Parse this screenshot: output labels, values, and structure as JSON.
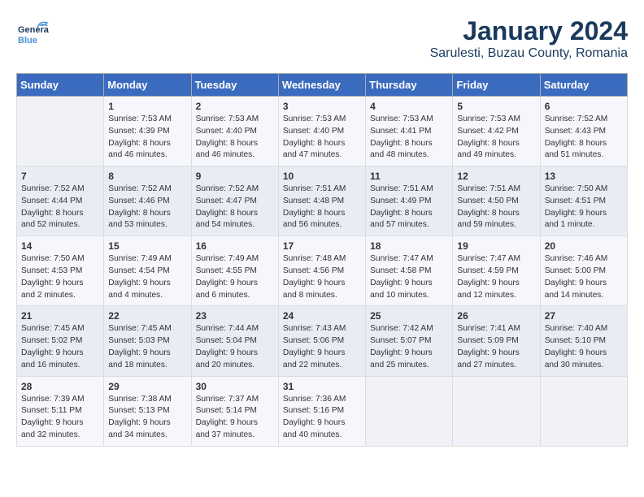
{
  "header": {
    "logo_general": "General",
    "logo_blue": "Blue",
    "title": "January 2024",
    "subtitle": "Sarulesti, Buzau County, Romania"
  },
  "days_of_week": [
    "Sunday",
    "Monday",
    "Tuesday",
    "Wednesday",
    "Thursday",
    "Friday",
    "Saturday"
  ],
  "weeks": [
    [
      {
        "day": "",
        "info": ""
      },
      {
        "day": "1",
        "info": "Sunrise: 7:53 AM\nSunset: 4:39 PM\nDaylight: 8 hours\nand 46 minutes."
      },
      {
        "day": "2",
        "info": "Sunrise: 7:53 AM\nSunset: 4:40 PM\nDaylight: 8 hours\nand 46 minutes."
      },
      {
        "day": "3",
        "info": "Sunrise: 7:53 AM\nSunset: 4:40 PM\nDaylight: 8 hours\nand 47 minutes."
      },
      {
        "day": "4",
        "info": "Sunrise: 7:53 AM\nSunset: 4:41 PM\nDaylight: 8 hours\nand 48 minutes."
      },
      {
        "day": "5",
        "info": "Sunrise: 7:53 AM\nSunset: 4:42 PM\nDaylight: 8 hours\nand 49 minutes."
      },
      {
        "day": "6",
        "info": "Sunrise: 7:52 AM\nSunset: 4:43 PM\nDaylight: 8 hours\nand 51 minutes."
      }
    ],
    [
      {
        "day": "7",
        "info": "Sunrise: 7:52 AM\nSunset: 4:44 PM\nDaylight: 8 hours\nand 52 minutes."
      },
      {
        "day": "8",
        "info": "Sunrise: 7:52 AM\nSunset: 4:46 PM\nDaylight: 8 hours\nand 53 minutes."
      },
      {
        "day": "9",
        "info": "Sunrise: 7:52 AM\nSunset: 4:47 PM\nDaylight: 8 hours\nand 54 minutes."
      },
      {
        "day": "10",
        "info": "Sunrise: 7:51 AM\nSunset: 4:48 PM\nDaylight: 8 hours\nand 56 minutes."
      },
      {
        "day": "11",
        "info": "Sunrise: 7:51 AM\nSunset: 4:49 PM\nDaylight: 8 hours\nand 57 minutes."
      },
      {
        "day": "12",
        "info": "Sunrise: 7:51 AM\nSunset: 4:50 PM\nDaylight: 8 hours\nand 59 minutes."
      },
      {
        "day": "13",
        "info": "Sunrise: 7:50 AM\nSunset: 4:51 PM\nDaylight: 9 hours\nand 1 minute."
      }
    ],
    [
      {
        "day": "14",
        "info": "Sunrise: 7:50 AM\nSunset: 4:53 PM\nDaylight: 9 hours\nand 2 minutes."
      },
      {
        "day": "15",
        "info": "Sunrise: 7:49 AM\nSunset: 4:54 PM\nDaylight: 9 hours\nand 4 minutes."
      },
      {
        "day": "16",
        "info": "Sunrise: 7:49 AM\nSunset: 4:55 PM\nDaylight: 9 hours\nand 6 minutes."
      },
      {
        "day": "17",
        "info": "Sunrise: 7:48 AM\nSunset: 4:56 PM\nDaylight: 9 hours\nand 8 minutes."
      },
      {
        "day": "18",
        "info": "Sunrise: 7:47 AM\nSunset: 4:58 PM\nDaylight: 9 hours\nand 10 minutes."
      },
      {
        "day": "19",
        "info": "Sunrise: 7:47 AM\nSunset: 4:59 PM\nDaylight: 9 hours\nand 12 minutes."
      },
      {
        "day": "20",
        "info": "Sunrise: 7:46 AM\nSunset: 5:00 PM\nDaylight: 9 hours\nand 14 minutes."
      }
    ],
    [
      {
        "day": "21",
        "info": "Sunrise: 7:45 AM\nSunset: 5:02 PM\nDaylight: 9 hours\nand 16 minutes."
      },
      {
        "day": "22",
        "info": "Sunrise: 7:45 AM\nSunset: 5:03 PM\nDaylight: 9 hours\nand 18 minutes."
      },
      {
        "day": "23",
        "info": "Sunrise: 7:44 AM\nSunset: 5:04 PM\nDaylight: 9 hours\nand 20 minutes."
      },
      {
        "day": "24",
        "info": "Sunrise: 7:43 AM\nSunset: 5:06 PM\nDaylight: 9 hours\nand 22 minutes."
      },
      {
        "day": "25",
        "info": "Sunrise: 7:42 AM\nSunset: 5:07 PM\nDaylight: 9 hours\nand 25 minutes."
      },
      {
        "day": "26",
        "info": "Sunrise: 7:41 AM\nSunset: 5:09 PM\nDaylight: 9 hours\nand 27 minutes."
      },
      {
        "day": "27",
        "info": "Sunrise: 7:40 AM\nSunset: 5:10 PM\nDaylight: 9 hours\nand 30 minutes."
      }
    ],
    [
      {
        "day": "28",
        "info": "Sunrise: 7:39 AM\nSunset: 5:11 PM\nDaylight: 9 hours\nand 32 minutes."
      },
      {
        "day": "29",
        "info": "Sunrise: 7:38 AM\nSunset: 5:13 PM\nDaylight: 9 hours\nand 34 minutes."
      },
      {
        "day": "30",
        "info": "Sunrise: 7:37 AM\nSunset: 5:14 PM\nDaylight: 9 hours\nand 37 minutes."
      },
      {
        "day": "31",
        "info": "Sunrise: 7:36 AM\nSunset: 5:16 PM\nDaylight: 9 hours\nand 40 minutes."
      },
      {
        "day": "",
        "info": ""
      },
      {
        "day": "",
        "info": ""
      },
      {
        "day": "",
        "info": ""
      }
    ]
  ]
}
